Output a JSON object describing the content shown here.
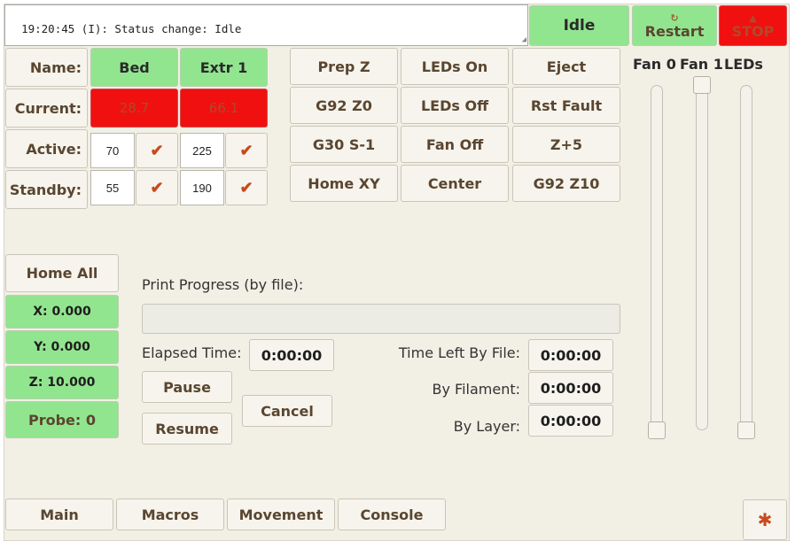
{
  "console": {
    "text": "19:20:45 (I): Status change: Idle"
  },
  "status": {
    "label": "Idle"
  },
  "controls": {
    "restart_label": "Restart",
    "stop_label": "STOP"
  },
  "temps": {
    "name_label": "Name:",
    "current_label": "Current:",
    "active_label": "Active:",
    "standby_label": "Standby:",
    "heaters": [
      {
        "name": "Bed",
        "current": "28.7",
        "active": "70",
        "standby": "55"
      },
      {
        "name": "Extr 1",
        "current": "66.1",
        "active": "225",
        "standby": "190"
      }
    ],
    "set_icon": "checkmark-icon",
    "set_glyph": "✔"
  },
  "macros": {
    "buttons": [
      "Prep Z",
      "LEDs On",
      "Eject",
      "G92 Z0",
      "LEDs Off",
      "Rst Fault",
      "G30 S-1",
      "Fan Off",
      "Z+5",
      "Home XY",
      "Center",
      "G92 Z10"
    ]
  },
  "sliders": {
    "labels": [
      "Fan 0",
      "Fan 1",
      "LEDs"
    ],
    "levels_percent": [
      0,
      100,
      0
    ]
  },
  "axes": {
    "home_all_label": "Home All",
    "x": "X: 0.000",
    "y": "Y: 0.000",
    "z": "Z: 10.000",
    "probe": "Probe: 0"
  },
  "print": {
    "progress_label": "Print Progress (by file):",
    "progress_percent": 0,
    "elapsed_label": "Elapsed Time:",
    "elapsed_value": "0:00:00",
    "pause_label": "Pause",
    "resume_label": "Resume",
    "cancel_label": "Cancel",
    "time_left_file_label": "Time Left By File:",
    "time_left_file_value": "0:00:00",
    "by_filament_label": "By Filament:",
    "by_filament_value": "0:00:00",
    "by_layer_label": "By Layer:",
    "by_layer_value": "0:00:00"
  },
  "tabs": [
    "Main",
    "Macros",
    "Movement",
    "Console"
  ],
  "settings": {
    "icon": "gear-icon",
    "glyph": "✱"
  },
  "colors": {
    "green": "#92e58f",
    "red": "#f01010",
    "text_brown": "#5a4630",
    "panel_bg": "#f2efe5"
  }
}
